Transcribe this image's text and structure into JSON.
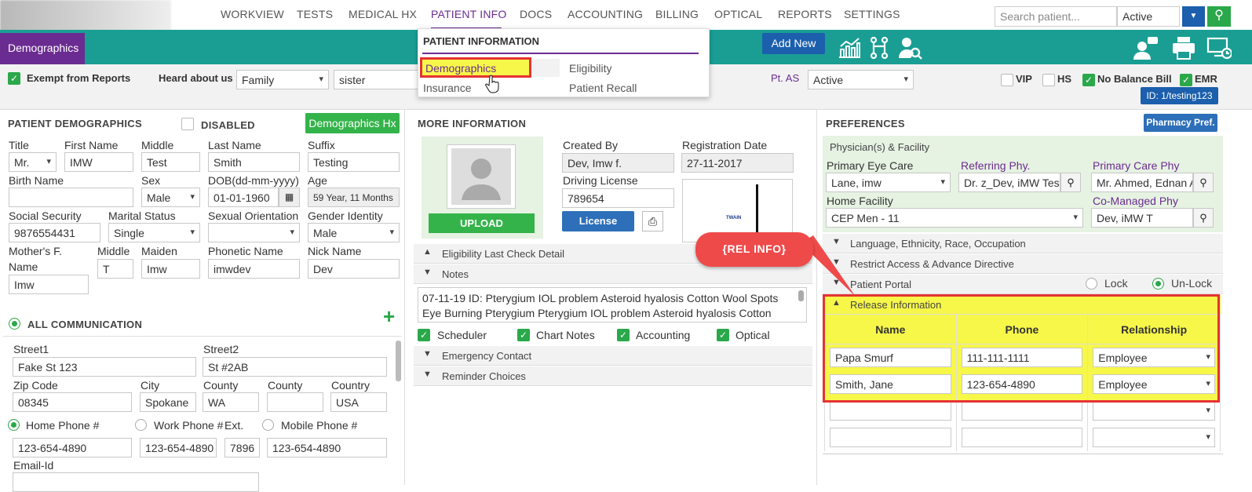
{
  "nav": {
    "items": [
      "WORKVIEW",
      "TESTS",
      "MEDICAL HX",
      "PATIENT INFO",
      "DOCS",
      "ACCOUNTING",
      "BILLING",
      "OPTICAL",
      "REPORTS",
      "SETTINGS"
    ],
    "search_placeholder": "Search patient...",
    "status_select": "Active"
  },
  "toolbar": {
    "section_tab": "Demographics",
    "add_new": "Add New"
  },
  "dropdown": {
    "title": "PATIENT INFORMATION",
    "col1": [
      "Demographics",
      "Insurance"
    ],
    "col2": [
      "Eligibility",
      "Patient Recall"
    ]
  },
  "row2": {
    "exempt_label": "Exempt from Reports",
    "heard_label": "Heard about us",
    "heard_value": "Family",
    "heard_detail": "sister",
    "ptas_label": "Pt. AS",
    "ptas_value": "Active",
    "vip": "VIP",
    "hs": "HS",
    "no_balance": "No Balance Bill",
    "emr": "EMR",
    "id_badge": "ID: 1/testing123"
  },
  "demographics": {
    "header": "PATIENT DEMOGRAPHICS",
    "disabled_label": "DISABLED",
    "hx_button": "Demographics Hx",
    "labels": {
      "title": "Title",
      "first": "First Name",
      "middle": "Middle",
      "last": "Last Name",
      "suffix": "Suffix",
      "birth_name": "Birth Name",
      "sex": "Sex",
      "dob": "DOB(dd-mm-yyyy)",
      "age": "Age",
      "ssn": "Social Security",
      "marital": "Marital Status",
      "orientation": "Sexual Orientation",
      "gender": "Gender Identity",
      "mother": "Mother's F.",
      "mother2": "Name",
      "mmiddle": "Middle",
      "maiden": "Maiden",
      "phonetic": "Phonetic Name",
      "nick": "Nick Name"
    },
    "values": {
      "title": "Mr.",
      "first": "IMW",
      "middle": "Test",
      "last": "Smith",
      "suffix": "Testing",
      "birth_name": "",
      "sex": "Male",
      "dob": "01-01-1960",
      "age": "59 Year, 11 Months",
      "ssn": "9876554431",
      "marital": "Single",
      "orientation": "",
      "gender": "Male",
      "mother": "Imw",
      "mmiddle": "T",
      "maiden": "Imw",
      "phonetic": "imwdev",
      "nick": "Dev"
    }
  },
  "communication": {
    "header": "ALL COMMUNICATION",
    "labels": {
      "street1": "Street1",
      "street2": "Street2",
      "zip": "Zip Code",
      "city": "City",
      "county": "County",
      "county2": "County",
      "country": "Country",
      "home": "Home Phone #",
      "work": "Work Phone #",
      "ext": "Ext.",
      "mobile": "Mobile Phone #",
      "email": "Email-Id"
    },
    "values": {
      "street1": "Fake St 123",
      "street2": "St #2AB",
      "zip": "08345",
      "city": "Spokane",
      "county": "WA",
      "county2": "",
      "country": "USA",
      "home": "123-654-4890",
      "work": "123-654-4890",
      "ext": "7896",
      "mobile": "123-654-4890"
    }
  },
  "more": {
    "header": "MORE INFORMATION",
    "upload": "UPLOAD",
    "created_by_label": "Created By",
    "created_by": "Dev, Imw f.",
    "reg_label": "Registration Date",
    "reg": "27-11-2017",
    "dl_label": "Driving License",
    "dl": "789654",
    "license_btn": "License",
    "twain": "TWAIN",
    "accordions": [
      "Eligibility Last Check Detail",
      "Notes",
      "Emergency Contact",
      "Reminder Choices"
    ],
    "notes_text": "07-11-19 ID: Pterygium IOL problem Asteroid hyalosis Cotton Wool Spots Eye Burning Pterygium Pterygium IOL problem Asteroid hyalosis Cotton Wool",
    "note_flags": [
      "Scheduler",
      "Chart Notes",
      "Accounting",
      "Optical"
    ]
  },
  "prefs": {
    "header": "PREFERENCES",
    "pharmacy_btn": "Pharmacy Pref.",
    "physician_header": "Physician(s) & Facility",
    "labels": {
      "primary_eye": "Primary Eye Care",
      "referring": "Referring Phy.",
      "primary_care": "Primary Care Phy",
      "home_facility": "Home Facility",
      "co_managed": "Co-Managed Phy"
    },
    "values": {
      "primary_eye": "Lane, imw",
      "referring": "Dr. z_Dev, iMW Test",
      "primary_care": "Mr. Ahmed, Ednan A",
      "home_facility": "CEP Men - 11",
      "co_managed": "Dev, iMW T"
    },
    "accordions": [
      "Language, Ethnicity, Race, Occupation",
      "Restrict Access & Advance Directive",
      "Patient Portal",
      "Release Information"
    ],
    "lock": "Lock",
    "unlock": "Un-Lock",
    "release_cols": [
      "Name",
      "Phone",
      "Relationship"
    ],
    "release_rows": [
      {
        "name": "Papa Smurf",
        "phone": "111-111-1111",
        "rel": "Employee"
      },
      {
        "name": "Smith, Jane",
        "phone": "123-654-4890",
        "rel": "Employee"
      },
      {
        "name": "",
        "phone": "",
        "rel": ""
      },
      {
        "name": "",
        "phone": "",
        "rel": ""
      }
    ]
  },
  "annotation": {
    "callout": "{REL INFO}",
    "color": "#ef4a4a"
  },
  "colors": {
    "teal": "#1a9e94",
    "purple": "#6b2c91",
    "blue": "#1b5fad",
    "green": "#2aa84a",
    "highlight": "#f7f74a"
  }
}
